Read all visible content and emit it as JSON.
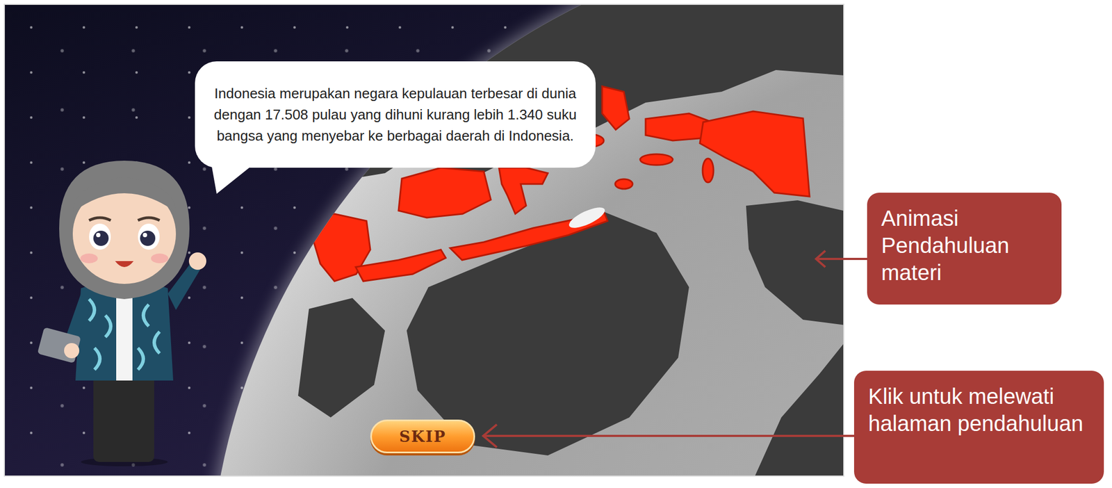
{
  "intro": {
    "speech": "Indonesia merupakan negara kepulauan terbesar di dunia dengan 17.508 pulau yang dihuni kurang lebih 1.340 suku bangsa yang menyebar ke berbagai daerah di Indonesia."
  },
  "skip_button": {
    "label": "SKIP"
  },
  "annotations": [
    {
      "text": "Animasi Pendahuluan materi"
    },
    {
      "text": "Klik untuk melewati halaman pendahuluan"
    }
  ]
}
